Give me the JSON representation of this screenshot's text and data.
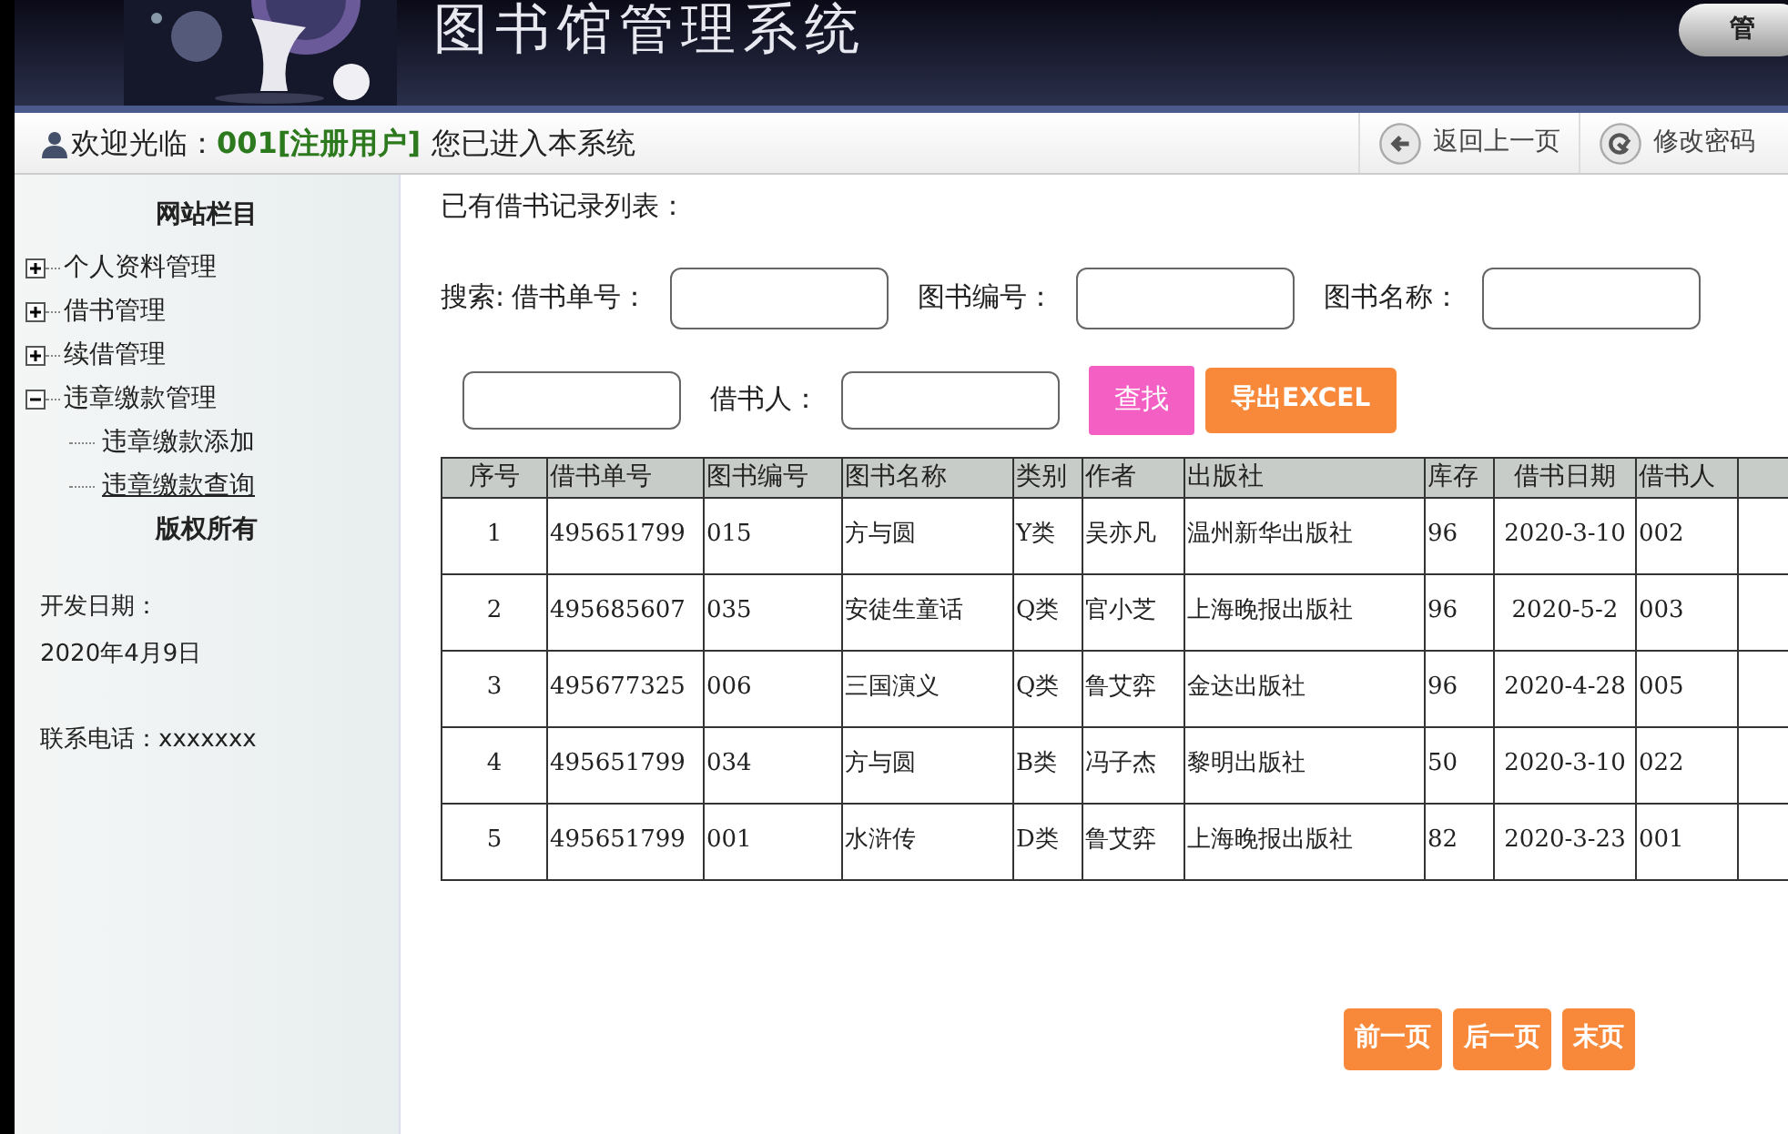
{
  "header": {
    "title": "图书馆管理系统",
    "corner_button": "管"
  },
  "welcome": {
    "prefix": "欢迎光临：",
    "user": "001[注册用户]",
    "suffix": "您已进入本系统"
  },
  "toolbar": [
    {
      "kind": "back",
      "label": "返回上一页"
    },
    {
      "kind": "password",
      "label": "修改密码"
    }
  ],
  "sidebar": {
    "heading": "网站栏目",
    "items": [
      {
        "label": "个人资料管理",
        "expanded": false
      },
      {
        "label": "借书管理",
        "expanded": false
      },
      {
        "label": "续借管理",
        "expanded": false
      },
      {
        "label": "违章缴款管理",
        "expanded": true,
        "children": [
          {
            "label": "违章缴款添加",
            "selected": false
          },
          {
            "label": "违章缴款查询",
            "selected": true
          }
        ]
      }
    ],
    "footer_heading": "版权所有",
    "date_label": "开发日期：",
    "date": "2020年4月9日",
    "phone": "联系电话：xxxxxxx"
  },
  "main": {
    "title": "已有借书记录列表：",
    "search_prefix": "搜索:",
    "fields": [
      {
        "kind": "text",
        "label": "借书单号："
      },
      {
        "kind": "text",
        "label": "图书编号："
      },
      {
        "kind": "text",
        "label": "图书名称："
      },
      {
        "kind": "text"
      },
      {
        "kind": "text",
        "label": "借书人："
      }
    ],
    "buttons": [
      {
        "kind": "search",
        "label": "查找"
      },
      {
        "kind": "export",
        "label": "导出EXCEL"
      }
    ],
    "table": {
      "columns": [
        "序号",
        "借书单号",
        "图书编号",
        "图书名称",
        "类别",
        "作者",
        "出版社",
        "库存",
        "借书日期",
        "借书人"
      ],
      "rows": [
        [
          "1",
          "495651799",
          "015",
          "方与圆",
          "Y类",
          "吴亦凡",
          "温州新华出版社",
          "96",
          "2020-3-10",
          "002"
        ],
        [
          "2",
          "495685607",
          "035",
          "安徒生童话",
          "Q类",
          "官小芝",
          "上海晚报出版社",
          "96",
          "2020-5-2",
          "003"
        ],
        [
          "3",
          "495677325",
          "006",
          "三国演义",
          "Q类",
          "鲁艾弈",
          "金达出版社",
          "96",
          "2020-4-28",
          "005"
        ],
        [
          "4",
          "495651799",
          "034",
          "方与圆",
          "B类",
          "冯子杰",
          "黎明出版社",
          "50",
          "2020-3-10",
          "022"
        ],
        [
          "5",
          "495651799",
          "001",
          "水浒传",
          "D类",
          "鲁艾弈",
          "上海晚报出版社",
          "82",
          "2020-3-23",
          "001"
        ]
      ]
    },
    "pagination": [
      "前一页",
      "后一页",
      "末页"
    ]
  }
}
